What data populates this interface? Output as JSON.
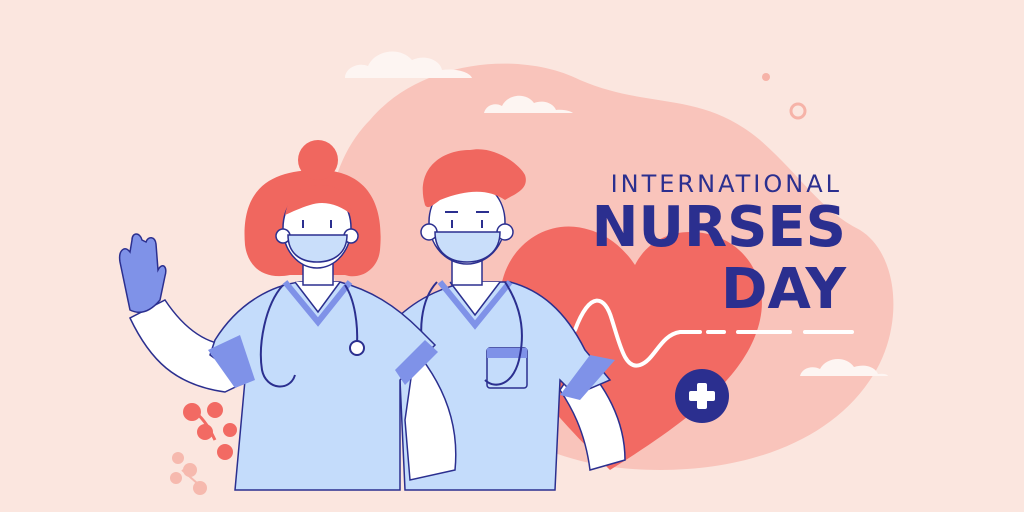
{
  "heading": {
    "line1": "INTERNATIONAL",
    "line2": "NURSES",
    "line3": "DAY"
  },
  "colors": {
    "background": "#fbe6df",
    "blob": "#f9c4bb",
    "heart": "#f26a63",
    "navy": "#2b2f8f",
    "scrubs": "#c4dcfb",
    "scrubs_dark": "#7f92e8",
    "hair": "#f0675f",
    "skin": "#ffffff",
    "mask": "#c9defa"
  },
  "icons": [
    "medical-cross-icon",
    "stethoscope-icon",
    "heartbeat-line-icon"
  ]
}
